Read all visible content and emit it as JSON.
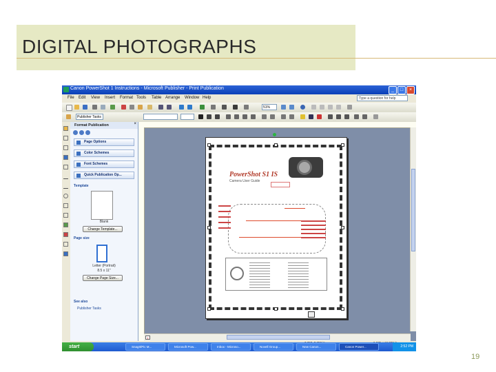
{
  "slide": {
    "title": "DIGITAL PHOTOGRAPHS",
    "number": "19"
  },
  "window": {
    "title": "Canon PowerShot 1 Instructions - Microsoft Publisher - Print Publication",
    "menu": [
      "File",
      "Edit",
      "View",
      "Insert",
      "Format",
      "Tools",
      "Table",
      "Arrange",
      "Window",
      "Help"
    ],
    "help_placeholder": "Type a question for help",
    "zoom": "51%",
    "style_box": "Publisher Tasks"
  },
  "task_pane": {
    "header": "Format Publication",
    "items": [
      "Page Options",
      "Color Schemes",
      "Font Schemes",
      "Quick Publication Op..."
    ],
    "template_label": "Template",
    "template_name": "Blank",
    "change_template_button": "Change Template...",
    "page_size_label": "Page size",
    "page_size_name": "Letter (Portrait)",
    "page_size_dims": "8.5 x 11\"",
    "change_page_size_button": "Change Page Size...",
    "see_also_label": "See also",
    "see_also_link": "Publisher Tasks"
  },
  "document": {
    "camera_title": "PowerShot S1 IS",
    "subtitle": "Camera User Guide",
    "page_indicator": "1"
  },
  "status": {
    "position": "3.250, 0.250 in.",
    "size": "6.875 x 10.000 in."
  },
  "taskbar": {
    "start_label": "start",
    "tasks": [
      "SnagIt/Pic M...",
      "Microsoft Pow...",
      "Inbox - Microso...",
      "Novell Group...",
      "New Canon...",
      "Canon Power..."
    ],
    "clock": "2:52 PM"
  }
}
